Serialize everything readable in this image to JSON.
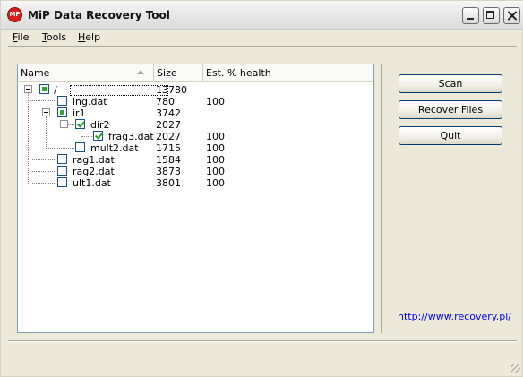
{
  "window": {
    "title": "MiP Data Recovery Tool",
    "icon_text": "MP"
  },
  "menu": {
    "file": {
      "label": "File",
      "mnemonic": "F",
      "rest": "ile"
    },
    "tools": {
      "label": "Tools",
      "mnemonic": "T",
      "rest": "ools"
    },
    "help": {
      "label": "Help",
      "mnemonic": "H",
      "rest": "elp"
    }
  },
  "tree": {
    "columns": {
      "name": "Name",
      "size": "Size",
      "health": "Est. % health"
    },
    "rows": [
      {
        "name": "/",
        "size": "13780",
        "health": "",
        "state": "partial",
        "expander": true
      },
      {
        "name": "ing.dat",
        "size": "780",
        "health": "100",
        "state": "unchecked",
        "expander": false
      },
      {
        "name": "ir1",
        "size": "3742",
        "health": "",
        "state": "partial",
        "expander": true
      },
      {
        "name": "dir2",
        "size": "2027",
        "health": "",
        "state": "checked",
        "expander": true
      },
      {
        "name": "frag3.dat",
        "size": "2027",
        "health": "100",
        "state": "checked",
        "expander": false
      },
      {
        "name": "mult2.dat",
        "size": "1715",
        "health": "100",
        "state": "unchecked",
        "expander": false
      },
      {
        "name": "rag1.dat",
        "size": "1584",
        "health": "100",
        "state": "unchecked",
        "expander": false
      },
      {
        "name": "rag2.dat",
        "size": "3873",
        "health": "100",
        "state": "unchecked",
        "expander": false
      },
      {
        "name": "ult1.dat",
        "size": "3801",
        "health": "100",
        "state": "unchecked",
        "expander": false
      }
    ]
  },
  "buttons": {
    "scan": "Scan",
    "recover": "Recover Files",
    "quit": "Quit"
  },
  "link": {
    "text": "http://www.recovery.pl/"
  },
  "colors": {
    "link": "#0000ff",
    "accent_checkbox": "#21a121",
    "icon_red": "#d42018"
  }
}
